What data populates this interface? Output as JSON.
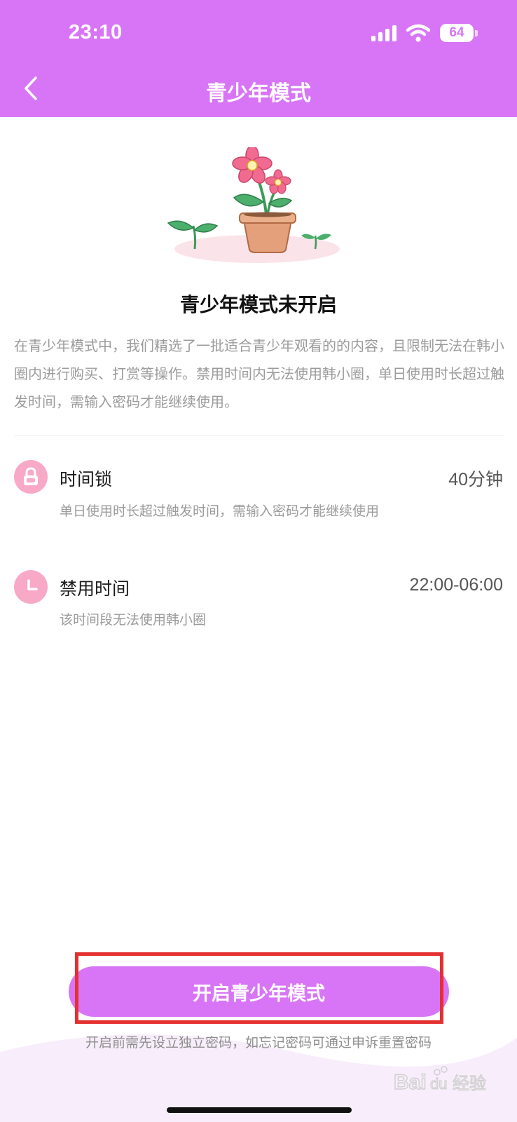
{
  "status_bar": {
    "time": "23:10",
    "battery": "64"
  },
  "nav": {
    "title": "青少年模式",
    "back_icon": "chevron-left-icon"
  },
  "mode_status": "青少年模式未开启",
  "intro_text": "在青少年模式中，我们精选了一批适合青少年观看的的内容，且限制无法在韩小圈内进行购买、打赏等操作。禁用时间内无法使用韩小圈，单日使用时长超过触发时间，需输入密码才能继续使用。",
  "settings": [
    {
      "icon": "lock-icon",
      "label": "时间锁",
      "value": "40分钟",
      "description": "单日使用时长超过触发时间，需输入密码才能继续使用"
    },
    {
      "icon": "clock-icon",
      "label": "禁用时间",
      "value": "22:00-06:00",
      "description": "该时间段无法使用韩小圈"
    }
  ],
  "cta": {
    "label": "开启青少年模式",
    "note": "开启前需先设立独立密码，如忘记密码可通过申诉重置密码"
  },
  "watermark": "Baidu经验",
  "colors": {
    "brand": "#d875f6",
    "icon_pink": "#f7a9c6",
    "highlight": "#e53030"
  }
}
